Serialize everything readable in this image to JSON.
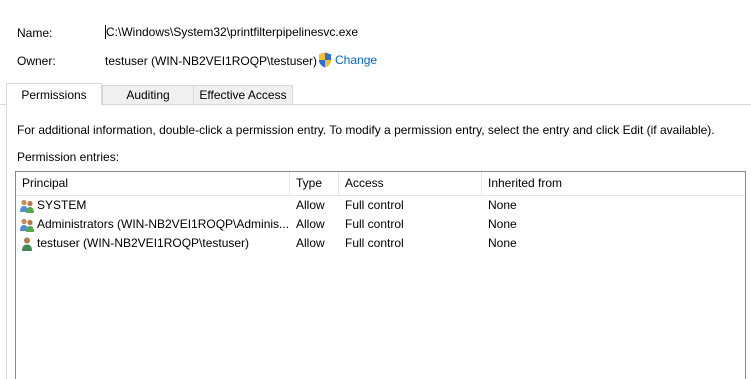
{
  "header": {
    "name_label": "Name:",
    "name_value": "C:\\Windows\\System32\\printfilterpipelinesvc.exe",
    "owner_label": "Owner:",
    "owner_value": "testuser (WIN-NB2VEI1ROQP\\testuser)",
    "change_label": "Change",
    "change_icon": "uac-shield-icon"
  },
  "tabs": [
    {
      "label": "Permissions",
      "active": true
    },
    {
      "label": "Auditing",
      "active": false
    },
    {
      "label": "Effective Access",
      "active": false
    }
  ],
  "permissions": {
    "info_text": "For additional information, double-click a permission entry. To modify a permission entry, select the entry and click Edit (if available).",
    "entries_label": "Permission entries:",
    "columns": [
      "Principal",
      "Type",
      "Access",
      "Inherited from"
    ],
    "rows": [
      {
        "icon": "group-users-icon",
        "principal": "SYSTEM",
        "type": "Allow",
        "access": "Full control",
        "inherited": "None"
      },
      {
        "icon": "group-users-icon",
        "principal": "Administrators (WIN-NB2VEI1ROQP\\Adminis...",
        "type": "Allow",
        "access": "Full control",
        "inherited": "None"
      },
      {
        "icon": "single-user-icon",
        "principal": "testuser (WIN-NB2VEI1ROQP\\testuser)",
        "type": "Allow",
        "access": "Full control",
        "inherited": "None"
      }
    ]
  },
  "colors": {
    "link": "#0066cc",
    "border": "#d9d9d9",
    "list_border": "#828790"
  }
}
